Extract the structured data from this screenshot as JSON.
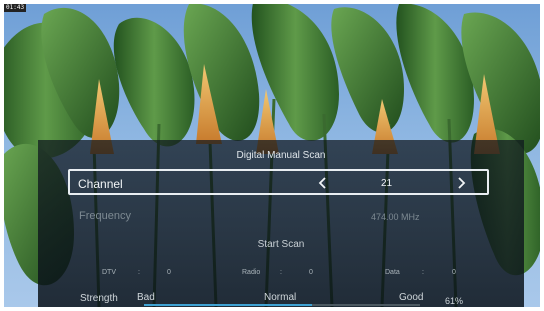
{
  "corner_tag": "01:43",
  "dialog": {
    "title": "Digital Manual Scan",
    "channel": {
      "label": "Channel",
      "value": "21"
    },
    "frequency": {
      "label": "Frequency",
      "value": "474.00 MHz"
    },
    "start_scan_label": "Start Scan",
    "counts": {
      "dtv_label": "DTV",
      "dtv_sep": ":",
      "dtv_value": "0",
      "radio_label": "Radio",
      "radio_sep": ":",
      "radio_value": "0",
      "data_label": "Data",
      "data_sep": ":",
      "data_value": "0"
    },
    "signal": {
      "label": "Strength",
      "bad": "Bad",
      "normal": "Normal",
      "good": "Good",
      "percent_text": "61%",
      "fraction": 0.61
    }
  },
  "colors": {
    "accent_bar": "#3fa2d3",
    "panel": "#0e161e",
    "sky": "#8fb7e2",
    "leaf": "#3f7a3a",
    "flower": "#e0a248"
  },
  "icons": {
    "prev": "chevron-left-icon",
    "next": "chevron-right-icon"
  }
}
